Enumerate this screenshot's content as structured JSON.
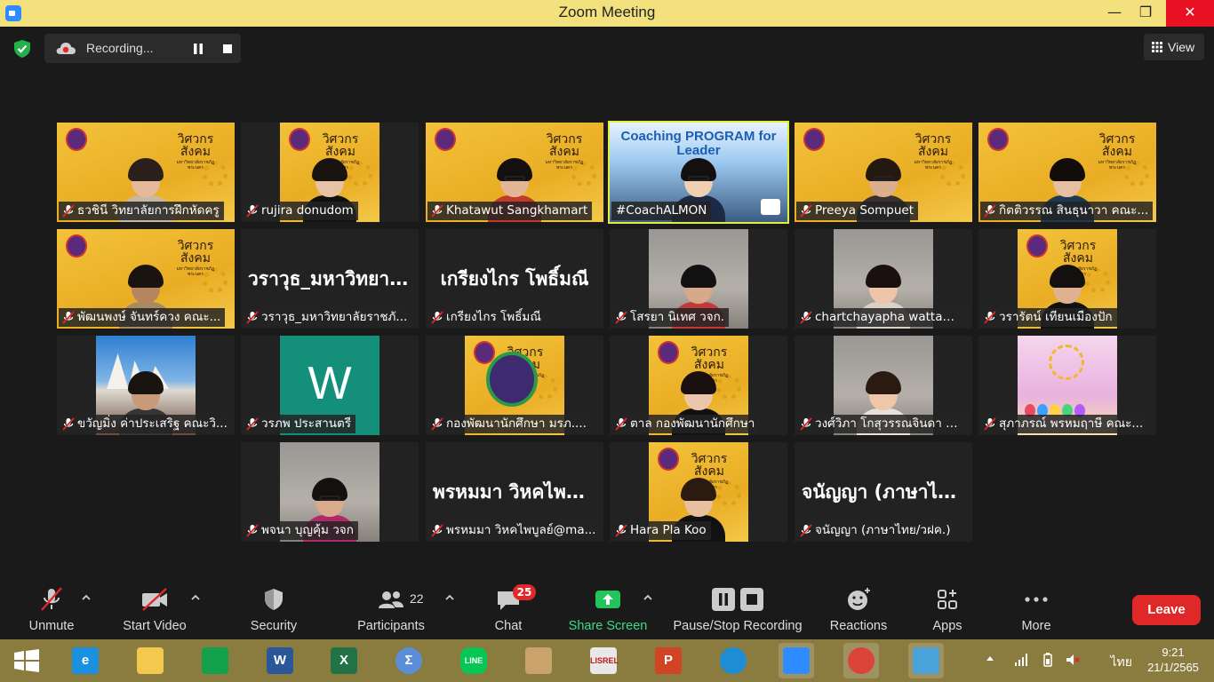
{
  "window": {
    "title": "Zoom Meeting",
    "minimize": "—",
    "maximize": "❐",
    "close": "✕"
  },
  "top": {
    "recording_label": "Recording...",
    "view_label": "View"
  },
  "tiles": [
    {
      "name": "ธวชินี  วิทยาลัยการฝึกหัดครู",
      "bg": "gold",
      "skin": "#e5b99a",
      "hair": "#2a1f1a",
      "shirt": "#c9b8a0"
    },
    {
      "name": "rujira donudom",
      "bg": "gold-center",
      "skin": "#e8c2a5",
      "hair": "#1a1410",
      "shirt": "#111111"
    },
    {
      "name": "Khatawut Sangkhamart",
      "bg": "gold",
      "skin": "#e3b697",
      "hair": "#151010",
      "shirt": "#c23a2a",
      "glasses": true
    },
    {
      "name": "#CoachALMON",
      "bg": "coach",
      "coach_text": "Coaching PROGRAM for Leader",
      "skin": "#f0cfb2",
      "hair": "#151010",
      "shirt": "#1d2a45",
      "glasses": true,
      "highlight": true,
      "plain_label": true
    },
    {
      "name": "Preeya Sompuet",
      "bg": "gold",
      "skin": "#dcae8e",
      "hair": "#251810",
      "shirt": "#3a3030",
      "glasses": true
    },
    {
      "name": "กิตติวรรณ สินธุนาวา คณะ...",
      "bg": "gold",
      "skin": "#e6bfa3",
      "hair": "#120c0a",
      "shirt": "#1d3a55"
    },
    {
      "name": "พัฒนพงษ์ จันทร์ควง คณะ...",
      "bg": "gold",
      "skin": "#b58560",
      "hair": "#1a1410",
      "shirt": "#a88a60"
    },
    {
      "name": "วราวุธ_มหาวิทยาลัยราชภั...",
      "bg": "text",
      "big": "วราวุธ_มหาวิทยาลัยราชภัฏ"
    },
    {
      "name": "เกรียงไกร โพธิ์มณี",
      "bg": "text",
      "big": "เกรียงไกร โพธิ์มณี"
    },
    {
      "name": "โสรยา นิเทศ วจก.",
      "bg": "gray-center",
      "skin": "#d7a98a",
      "hair": "#111111",
      "shirt": "#c23a3a"
    },
    {
      "name": "chartchayapha wattam...",
      "bg": "gray-center",
      "skin": "#efc5aa",
      "hair": "#1a1010",
      "shirt": "#d9d0c7"
    },
    {
      "name": "วรารัตน์ เทียนเมืองปัก",
      "bg": "gold-center",
      "skin": "#e0b190",
      "hair": "#151010",
      "shirt": "#111111"
    },
    {
      "name": "ขวัญมิ่ง ค่าประเสริฐ คณะวิ...",
      "bg": "sky-center",
      "skin": "#c99a7a",
      "hair": "#1a1410",
      "shirt": "#353535"
    },
    {
      "name": "วรภพ ประสานตรี",
      "bg": "teal-center",
      "big": "W"
    },
    {
      "name": "กองพัฒนานักศึกษา มรภ....",
      "bg": "gold-center",
      "noperson": true
    },
    {
      "name": "ตาล กองพัฒนานักศึกษา",
      "bg": "gold-center",
      "skin": "#ecc6a8",
      "hair": "#1a1010",
      "shirt": "#111111"
    },
    {
      "name": "วงศ์วิภา โกสุวรรณจินดา ค...",
      "bg": "gray-center",
      "skin": "#f0c6ab",
      "hair": "#2a1a12",
      "shirt": "#e7e0db"
    },
    {
      "name": "สุภาภรณ์ พรหมฤาษี คณะ...",
      "bg": "party-center",
      "noperson": true
    },
    {
      "name": "พจนา บุญคุ้ม วจก",
      "bg": "gray-center",
      "skin": "#d9ab8c",
      "hair": "#151010",
      "shirt": "#b02a68",
      "glasses": true
    },
    {
      "name": "พรหมมา วิหคไพบูลย์@ma...",
      "bg": "text",
      "big": "พรหมมา วิหคไพบูลย์"
    },
    {
      "name": "Hara Pla Koo",
      "bg": "gold-center",
      "skin": "#e8bf9f",
      "hair": "#2a1a10",
      "shirt": "#111111"
    },
    {
      "name": "จนัญญา (ภาษาไทย/วฝค.)",
      "bg": "text",
      "big": "จนัญญา (ภาษาไทย/วฝค.)"
    }
  ],
  "brand": {
    "line1": "วิศวกร",
    "line2": "สังคม",
    "small": "มหาวิทยาลัยราชภัฏพระนคร"
  },
  "toolbar": {
    "unmute": "Unmute",
    "start_video": "Start Video",
    "security": "Security",
    "participants": "Participants",
    "participants_count": "22",
    "chat": "Chat",
    "chat_badge": "25",
    "share_screen": "Share Screen",
    "pause_stop_recording": "Pause/Stop Recording",
    "reactions": "Reactions",
    "apps": "Apps",
    "more": "More",
    "leave": "Leave"
  },
  "taskbar": {
    "apps": [
      {
        "icon": "windows-start-icon"
      },
      {
        "icon": "internet-explorer-icon",
        "color": "#1b8fe0",
        "glyph": "e"
      },
      {
        "icon": "file-explorer-icon",
        "color": "#f2c94c",
        "glyph": ""
      },
      {
        "icon": "store-icon",
        "color": "#12a04a",
        "glyph": ""
      },
      {
        "icon": "word-icon",
        "color": "#2b579a",
        "glyph": "W"
      },
      {
        "icon": "excel-icon",
        "color": "#217346",
        "glyph": "X"
      },
      {
        "icon": "math-icon",
        "color": "#5c8ed8",
        "glyph": "Σ"
      },
      {
        "icon": "line-icon",
        "color": "#06c755",
        "glyph": "LINE"
      },
      {
        "icon": "paint-icon",
        "color": "#c9a36a",
        "glyph": ""
      },
      {
        "icon": "lisrel-icon",
        "color": "#e8e8e8",
        "glyph": "LISREL"
      },
      {
        "icon": "powerpoint-icon",
        "color": "#d04423",
        "glyph": "P"
      },
      {
        "icon": "edge-icon",
        "color": "#1d8ed6",
        "glyph": ""
      },
      {
        "icon": "zoom-icon",
        "color": "#2d8cff",
        "glyph": ""
      },
      {
        "icon": "chrome-icon",
        "color": "#db4437",
        "glyph": ""
      },
      {
        "icon": "remote-desktop-icon",
        "color": "#4aa3d8",
        "glyph": ""
      }
    ],
    "lang": "ไทย",
    "time": "9:21",
    "date": "21/1/2565"
  }
}
